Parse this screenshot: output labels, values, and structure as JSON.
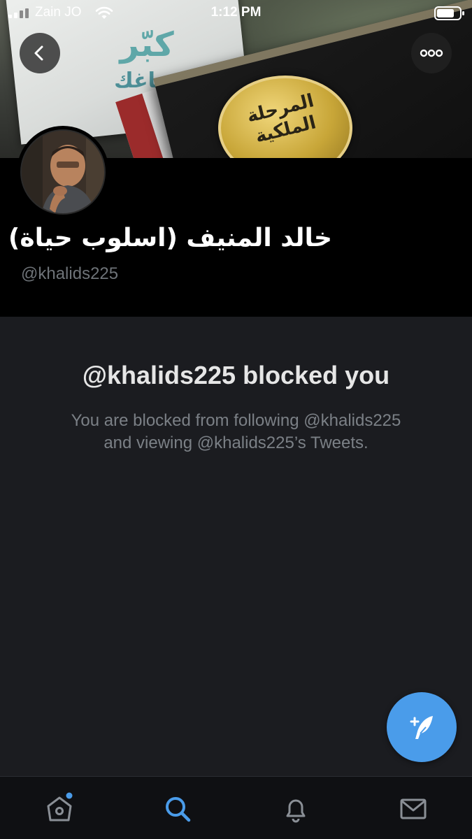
{
  "status_bar": {
    "carrier": "Zain JO",
    "time": "1:12 PM"
  },
  "banner": {
    "book_title": "كبّر",
    "book_subtitle": "دماغك",
    "emblem_text": "المرحلة الملكية"
  },
  "profile": {
    "display_name": "خالد المنيف (اسلوب حياة)",
    "handle": "@khalids225"
  },
  "blocked": {
    "title": "@khalids225 blocked you",
    "description_line1": "You are blocked from following @khalids225",
    "description_line2": "and viewing @khalids225’s Tweets."
  },
  "icons": {
    "back": "chevron-left-icon",
    "more": "more-horizontal-icon",
    "compose": "compose-tweet-icon",
    "home": "home-icon",
    "search": "search-icon",
    "notifications": "bell-icon",
    "messages": "mail-icon"
  },
  "colors": {
    "accent": "#4a9cea",
    "background": "#1b1c20",
    "header": "#000000",
    "muted_text": "#7b8086"
  }
}
